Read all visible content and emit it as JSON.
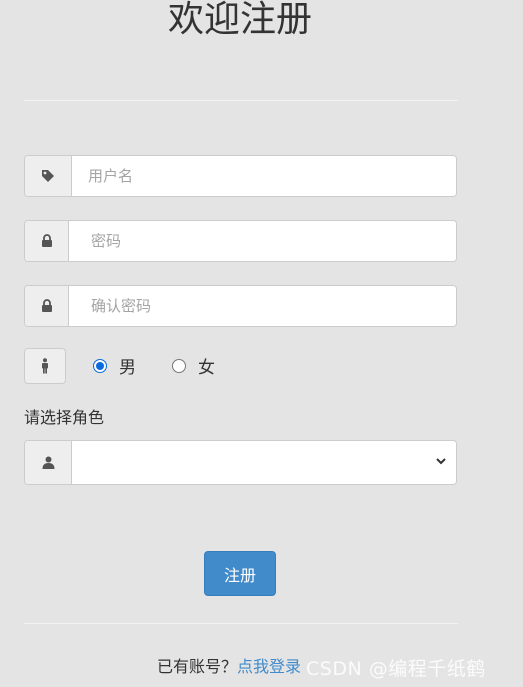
{
  "page": {
    "title": "欢迎注册"
  },
  "form": {
    "username": {
      "placeholder": "用户名",
      "value": ""
    },
    "password": {
      "placeholder": "密码",
      "value": ""
    },
    "confirm_password": {
      "placeholder": "确认密码",
      "value": ""
    },
    "gender": {
      "options": [
        {
          "label": "男",
          "checked": true
        },
        {
          "label": "女",
          "checked": false
        }
      ]
    },
    "role": {
      "label": "请选择角色",
      "selected": ""
    },
    "submit_label": "注册"
  },
  "footer": {
    "prompt": "已有账号？",
    "login_link": "点我登录"
  },
  "watermark": "CSDN @编程千纸鹤",
  "icons": {
    "username": "tag-icon",
    "password": "lock-icon",
    "confirm_password": "lock-icon",
    "gender": "person-icon",
    "role": "user-icon"
  },
  "colors": {
    "background": "#e4e4e4",
    "primary": "#428bca",
    "radio_accent": "#0a6bde"
  }
}
